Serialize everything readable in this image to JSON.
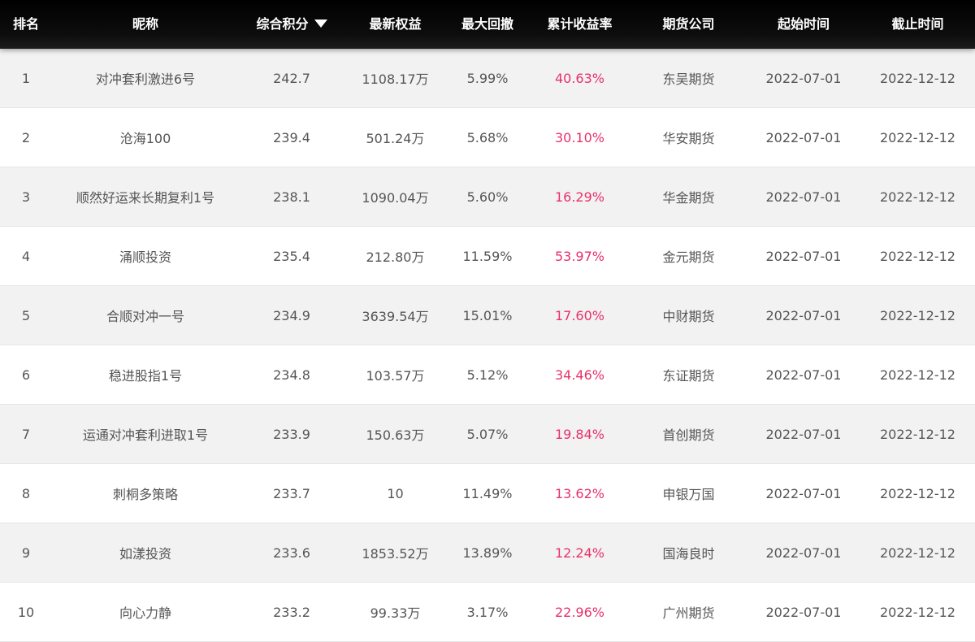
{
  "colors": {
    "header_bg": "#000000",
    "header_text": "#ffffff",
    "row_alt_bg": "#f2f2f2",
    "row_bg": "#ffffff",
    "return_text": "#e8306a",
    "body_text": "#555555"
  },
  "header": {
    "rank": "排名",
    "name": "昵称",
    "score": "综合积分",
    "equity": "最新权益",
    "drawdown": "最大回撤",
    "return": "累计收益率",
    "broker": "期货公司",
    "start": "起始时间",
    "end": "截止时间",
    "sort_icon": "caret-down-icon"
  },
  "rows": [
    {
      "rank": "1",
      "name": "对冲套利激进6号",
      "score": "242.7",
      "equity": "1108.17万",
      "drawdown": "5.99%",
      "return": "40.63%",
      "broker": "东吴期货",
      "start": "2022-07-01",
      "end": "2022-12-12"
    },
    {
      "rank": "2",
      "name": "沧海100",
      "score": "239.4",
      "equity": "501.24万",
      "drawdown": "5.68%",
      "return": "30.10%",
      "broker": "华安期货",
      "start": "2022-07-01",
      "end": "2022-12-12"
    },
    {
      "rank": "3",
      "name": "顺然好运来长期复利1号",
      "score": "238.1",
      "equity": "1090.04万",
      "drawdown": "5.60%",
      "return": "16.29%",
      "broker": "华金期货",
      "start": "2022-07-01",
      "end": "2022-12-12"
    },
    {
      "rank": "4",
      "name": "涌顺投资",
      "score": "235.4",
      "equity": "212.80万",
      "drawdown": "11.59%",
      "return": "53.97%",
      "broker": "金元期货",
      "start": "2022-07-01",
      "end": "2022-12-12"
    },
    {
      "rank": "5",
      "name": "合顺对冲一号",
      "score": "234.9",
      "equity": "3639.54万",
      "drawdown": "15.01%",
      "return": "17.60%",
      "broker": "中财期货",
      "start": "2022-07-01",
      "end": "2022-12-12"
    },
    {
      "rank": "6",
      "name": "稳进股指1号",
      "score": "234.8",
      "equity": "103.57万",
      "drawdown": "5.12%",
      "return": "34.46%",
      "broker": "东证期货",
      "start": "2022-07-01",
      "end": "2022-12-12"
    },
    {
      "rank": "7",
      "name": "运通对冲套利进取1号",
      "score": "233.9",
      "equity": "150.63万",
      "drawdown": "5.07%",
      "return": "19.84%",
      "broker": "首创期货",
      "start": "2022-07-01",
      "end": "2022-12-12"
    },
    {
      "rank": "8",
      "name": "刺桐多策略",
      "score": "233.7",
      "equity": "10",
      "drawdown": "11.49%",
      "return": "13.62%",
      "broker": "申银万国",
      "start": "2022-07-01",
      "end": "2022-12-12"
    },
    {
      "rank": "9",
      "name": "如漾投资",
      "score": "233.6",
      "equity": "1853.52万",
      "drawdown": "13.89%",
      "return": "12.24%",
      "broker": "国海良时",
      "start": "2022-07-01",
      "end": "2022-12-12"
    },
    {
      "rank": "10",
      "name": "向心力静",
      "score": "233.2",
      "equity": "99.33万",
      "drawdown": "3.17%",
      "return": "22.96%",
      "broker": "广州期货",
      "start": "2022-07-01",
      "end": "2022-12-12"
    }
  ]
}
